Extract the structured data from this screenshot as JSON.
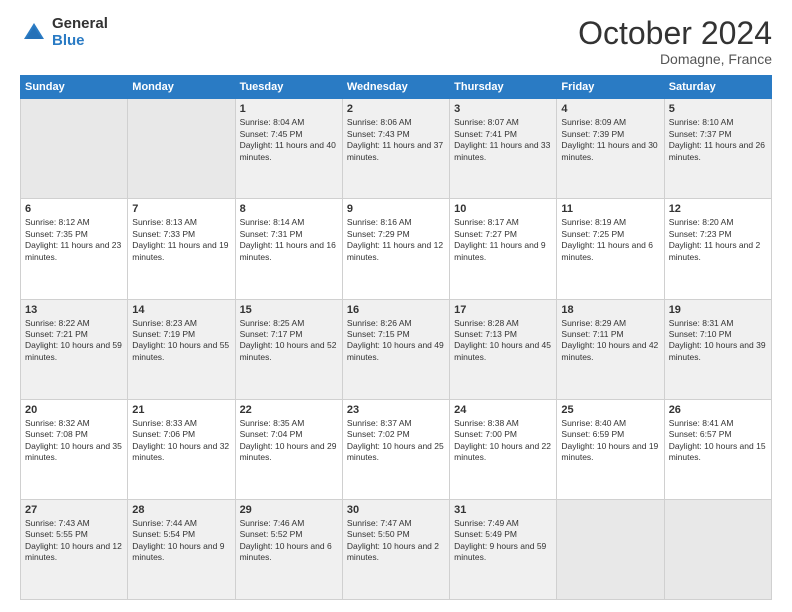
{
  "logo": {
    "general": "General",
    "blue": "Blue"
  },
  "title": "October 2024",
  "subtitle": "Domagne, France",
  "days": [
    "Sunday",
    "Monday",
    "Tuesday",
    "Wednesday",
    "Thursday",
    "Friday",
    "Saturday"
  ],
  "weeks": [
    [
      {
        "day": "",
        "empty": true
      },
      {
        "day": "",
        "empty": true
      },
      {
        "day": "1",
        "sunrise": "Sunrise: 8:04 AM",
        "sunset": "Sunset: 7:45 PM",
        "daylight": "Daylight: 11 hours and 40 minutes."
      },
      {
        "day": "2",
        "sunrise": "Sunrise: 8:06 AM",
        "sunset": "Sunset: 7:43 PM",
        "daylight": "Daylight: 11 hours and 37 minutes."
      },
      {
        "day": "3",
        "sunrise": "Sunrise: 8:07 AM",
        "sunset": "Sunset: 7:41 PM",
        "daylight": "Daylight: 11 hours and 33 minutes."
      },
      {
        "day": "4",
        "sunrise": "Sunrise: 8:09 AM",
        "sunset": "Sunset: 7:39 PM",
        "daylight": "Daylight: 11 hours and 30 minutes."
      },
      {
        "day": "5",
        "sunrise": "Sunrise: 8:10 AM",
        "sunset": "Sunset: 7:37 PM",
        "daylight": "Daylight: 11 hours and 26 minutes."
      }
    ],
    [
      {
        "day": "6",
        "sunrise": "Sunrise: 8:12 AM",
        "sunset": "Sunset: 7:35 PM",
        "daylight": "Daylight: 11 hours and 23 minutes."
      },
      {
        "day": "7",
        "sunrise": "Sunrise: 8:13 AM",
        "sunset": "Sunset: 7:33 PM",
        "daylight": "Daylight: 11 hours and 19 minutes."
      },
      {
        "day": "8",
        "sunrise": "Sunrise: 8:14 AM",
        "sunset": "Sunset: 7:31 PM",
        "daylight": "Daylight: 11 hours and 16 minutes."
      },
      {
        "day": "9",
        "sunrise": "Sunrise: 8:16 AM",
        "sunset": "Sunset: 7:29 PM",
        "daylight": "Daylight: 11 hours and 12 minutes."
      },
      {
        "day": "10",
        "sunrise": "Sunrise: 8:17 AM",
        "sunset": "Sunset: 7:27 PM",
        "daylight": "Daylight: 11 hours and 9 minutes."
      },
      {
        "day": "11",
        "sunrise": "Sunrise: 8:19 AM",
        "sunset": "Sunset: 7:25 PM",
        "daylight": "Daylight: 11 hours and 6 minutes."
      },
      {
        "day": "12",
        "sunrise": "Sunrise: 8:20 AM",
        "sunset": "Sunset: 7:23 PM",
        "daylight": "Daylight: 11 hours and 2 minutes."
      }
    ],
    [
      {
        "day": "13",
        "sunrise": "Sunrise: 8:22 AM",
        "sunset": "Sunset: 7:21 PM",
        "daylight": "Daylight: 10 hours and 59 minutes."
      },
      {
        "day": "14",
        "sunrise": "Sunrise: 8:23 AM",
        "sunset": "Sunset: 7:19 PM",
        "daylight": "Daylight: 10 hours and 55 minutes."
      },
      {
        "day": "15",
        "sunrise": "Sunrise: 8:25 AM",
        "sunset": "Sunset: 7:17 PM",
        "daylight": "Daylight: 10 hours and 52 minutes."
      },
      {
        "day": "16",
        "sunrise": "Sunrise: 8:26 AM",
        "sunset": "Sunset: 7:15 PM",
        "daylight": "Daylight: 10 hours and 49 minutes."
      },
      {
        "day": "17",
        "sunrise": "Sunrise: 8:28 AM",
        "sunset": "Sunset: 7:13 PM",
        "daylight": "Daylight: 10 hours and 45 minutes."
      },
      {
        "day": "18",
        "sunrise": "Sunrise: 8:29 AM",
        "sunset": "Sunset: 7:11 PM",
        "daylight": "Daylight: 10 hours and 42 minutes."
      },
      {
        "day": "19",
        "sunrise": "Sunrise: 8:31 AM",
        "sunset": "Sunset: 7:10 PM",
        "daylight": "Daylight: 10 hours and 39 minutes."
      }
    ],
    [
      {
        "day": "20",
        "sunrise": "Sunrise: 8:32 AM",
        "sunset": "Sunset: 7:08 PM",
        "daylight": "Daylight: 10 hours and 35 minutes."
      },
      {
        "day": "21",
        "sunrise": "Sunrise: 8:33 AM",
        "sunset": "Sunset: 7:06 PM",
        "daylight": "Daylight: 10 hours and 32 minutes."
      },
      {
        "day": "22",
        "sunrise": "Sunrise: 8:35 AM",
        "sunset": "Sunset: 7:04 PM",
        "daylight": "Daylight: 10 hours and 29 minutes."
      },
      {
        "day": "23",
        "sunrise": "Sunrise: 8:37 AM",
        "sunset": "Sunset: 7:02 PM",
        "daylight": "Daylight: 10 hours and 25 minutes."
      },
      {
        "day": "24",
        "sunrise": "Sunrise: 8:38 AM",
        "sunset": "Sunset: 7:00 PM",
        "daylight": "Daylight: 10 hours and 22 minutes."
      },
      {
        "day": "25",
        "sunrise": "Sunrise: 8:40 AM",
        "sunset": "Sunset: 6:59 PM",
        "daylight": "Daylight: 10 hours and 19 minutes."
      },
      {
        "day": "26",
        "sunrise": "Sunrise: 8:41 AM",
        "sunset": "Sunset: 6:57 PM",
        "daylight": "Daylight: 10 hours and 15 minutes."
      }
    ],
    [
      {
        "day": "27",
        "sunrise": "Sunrise: 7:43 AM",
        "sunset": "Sunset: 5:55 PM",
        "daylight": "Daylight: 10 hours and 12 minutes."
      },
      {
        "day": "28",
        "sunrise": "Sunrise: 7:44 AM",
        "sunset": "Sunset: 5:54 PM",
        "daylight": "Daylight: 10 hours and 9 minutes."
      },
      {
        "day": "29",
        "sunrise": "Sunrise: 7:46 AM",
        "sunset": "Sunset: 5:52 PM",
        "daylight": "Daylight: 10 hours and 6 minutes."
      },
      {
        "day": "30",
        "sunrise": "Sunrise: 7:47 AM",
        "sunset": "Sunset: 5:50 PM",
        "daylight": "Daylight: 10 hours and 2 minutes."
      },
      {
        "day": "31",
        "sunrise": "Sunrise: 7:49 AM",
        "sunset": "Sunset: 5:49 PM",
        "daylight": "Daylight: 9 hours and 59 minutes."
      },
      {
        "day": "",
        "empty": true
      },
      {
        "day": "",
        "empty": true
      }
    ]
  ]
}
